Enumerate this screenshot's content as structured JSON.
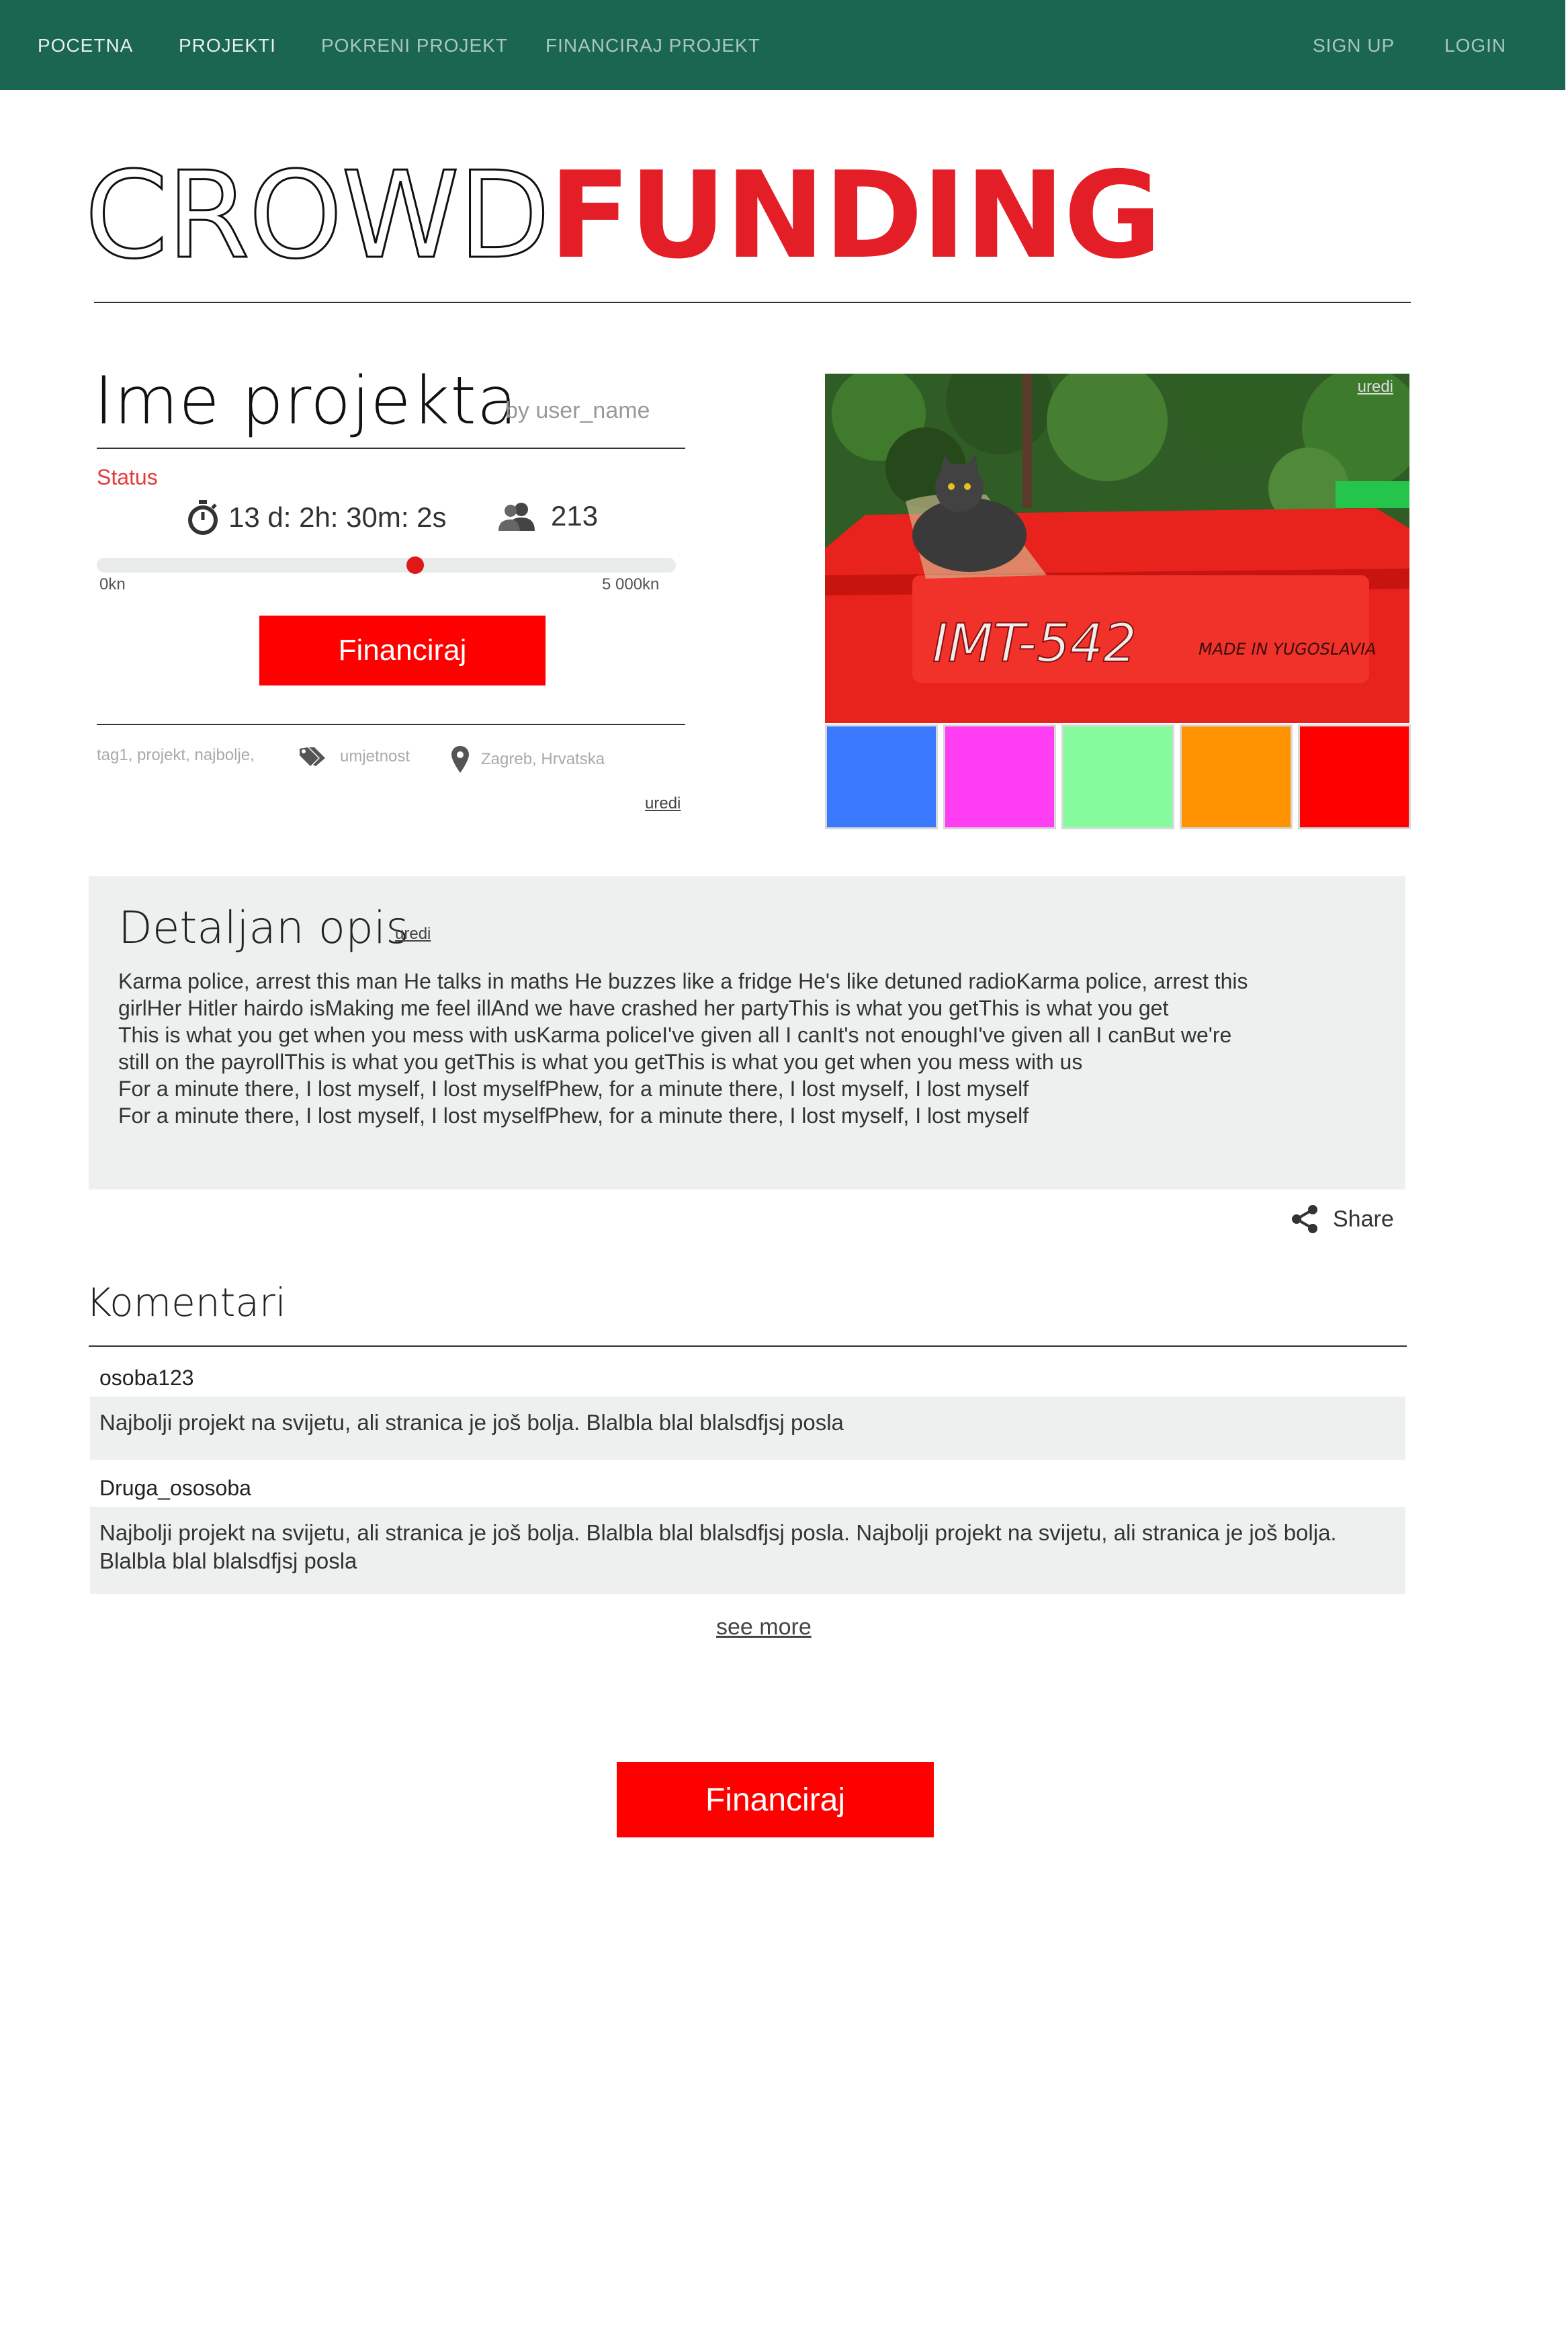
{
  "nav": {
    "items": [
      "POCETNA",
      "PROJEKTI",
      "POKRENI PROJEKT",
      "FINANCIRAJ PROJEKT"
    ],
    "sign_up": "SIGN UP",
    "login": "LOGIN"
  },
  "logo": {
    "part1": "CROWD",
    "part2": "FUNDING"
  },
  "project": {
    "title": "Ime projekta",
    "by": "by user_name",
    "status_label": "Status",
    "time_left": "13 d: 2h: 30m: 2s",
    "backers": "213",
    "progress": {
      "min_label": "0kn",
      "max_label": "5 000kn",
      "fraction": 0.55
    },
    "fund_button": "Financiraj",
    "tags": "tag1, projekt, najbolje,",
    "category": "umjetnost",
    "location": "Zagreb, Hrvatska",
    "edit": "uredi"
  },
  "gallery": {
    "edit": "uredi",
    "thumb_colors": [
      "#3a78ff",
      "#ff3df2",
      "#86fb9d",
      "#ff9200",
      "#ff0000"
    ]
  },
  "description": {
    "title": "Detaljan opis",
    "edit": "uredi",
    "lines": [
      "Karma police, arrest this man He talks in maths He buzzes like a fridge He's like detuned radioKarma police, arrest this",
      "girlHer Hitler hairdo isMaking me feel illAnd we have crashed her partyThis is what you getThis is what you get",
      "This is what you get when you mess with usKarma policeI've given all I canIt's not enoughI've given all I canBut we're",
      "still on the payrollThis is what you getThis is what you getThis is what you get when you mess with us",
      "For a minute there, I lost myself, I lost myselfPhew, for a minute there, I lost myself, I lost myself",
      "For a minute there, I lost myself, I lost myselfPhew, for a minute there, I lost myself, I lost myself"
    ]
  },
  "share": {
    "label": "Share"
  },
  "comments": {
    "title": "Komentari",
    "items": [
      {
        "user": "osoba123",
        "text": "Najbolji projekt na svijetu, ali stranica je još bolja. Blalbla blal blalsdfjsj posla"
      },
      {
        "user": "Druga_ososoba",
        "text": "Najbolji projekt na svijetu, ali stranica je još bolja. Blalbla blal blalsdfjsj posla. Najbolji projekt na svijetu, ali stranica je još bolja. Blalbla blal blalsdfjsj posla"
      }
    ],
    "see_more": "see more"
  },
  "bottom_button": "Financiraj",
  "colors": {
    "nav_bg": "#1a6651",
    "accent_red": "#ff0000",
    "panel_bg": "#edf0ef"
  }
}
